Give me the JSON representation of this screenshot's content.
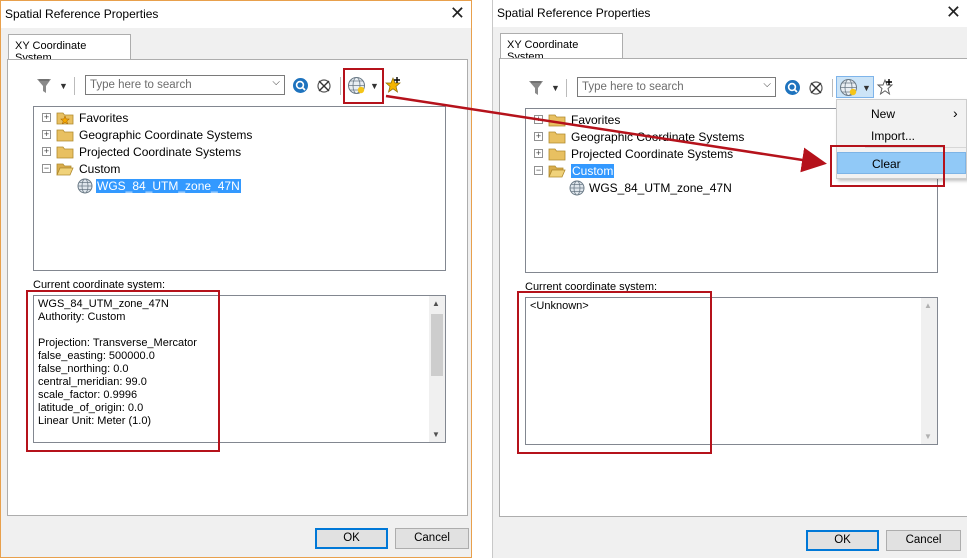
{
  "left_dialog": {
    "title": "Spatial Reference Properties",
    "close_glyph": "✕",
    "tab": "XY Coordinate System",
    "search_placeholder": "Type here to search",
    "tree": [
      {
        "label": "Favorites",
        "expander": "+",
        "icon": "favorites-folder-icon"
      },
      {
        "label": "Geographic Coordinate Systems",
        "expander": "+",
        "icon": "folder-icon"
      },
      {
        "label": "Projected Coordinate Systems",
        "expander": "+",
        "icon": "folder-icon"
      },
      {
        "label": "Custom",
        "expander": "−",
        "icon": "open-folder-icon"
      },
      {
        "label": "WGS_84_UTM_zone_47N",
        "icon": "globe-icon",
        "selected": true
      }
    ],
    "current_cs_label": "Current coordinate system:",
    "current_cs_text": "WGS_84_UTM_zone_47N\nAuthority: Custom\n\nProjection: Transverse_Mercator\nfalse_easting: 500000.0\nfalse_northing: 0.0\ncentral_meridian: 99.0\nscale_factor: 0.9996\nlatitude_of_origin: 0.0\nLinear Unit: Meter (1.0)",
    "ok": "OK",
    "cancel": "Cancel"
  },
  "right_dialog": {
    "title": "Spatial Reference Properties",
    "close_glyph": "✕",
    "tab": "XY Coordinate System",
    "search_placeholder": "Type here to search",
    "tree": [
      {
        "label": "Favorites",
        "expander": "+",
        "icon": "folder-icon"
      },
      {
        "label": "Geographic Coordinate Systems",
        "expander": "+",
        "icon": "folder-icon"
      },
      {
        "label": "Projected Coordinate Systems",
        "expander": "+",
        "icon": "folder-icon"
      },
      {
        "label": "Custom",
        "expander": "−",
        "icon": "open-folder-icon",
        "selected": true
      },
      {
        "label": "WGS_84_UTM_zone_47N",
        "icon": "globe-icon"
      }
    ],
    "current_cs_label": "Current coordinate system:",
    "current_cs_text": "<Unknown>",
    "ok": "OK",
    "cancel": "Cancel",
    "context_menu": {
      "items": [
        {
          "label": "New",
          "submenu_arrow": "›"
        },
        {
          "label": "Import..."
        },
        {
          "label": "Clear",
          "highlighted": true
        }
      ]
    }
  },
  "colors": {
    "annotation_red": "#b5121b",
    "selection_blue": "#3399ff",
    "menu_highlight": "#91c9f7"
  }
}
